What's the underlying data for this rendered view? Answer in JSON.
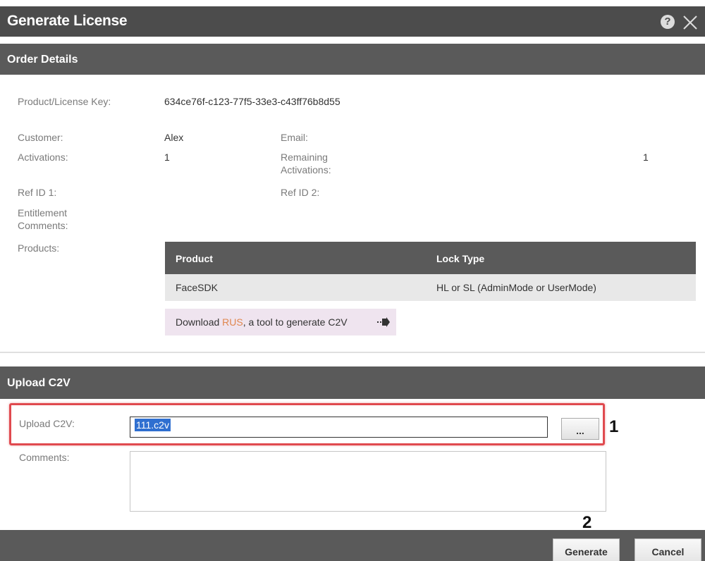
{
  "dialog": {
    "title": "Generate License",
    "help_glyph": "?",
    "icons": [
      "help-icon",
      "close-icon"
    ]
  },
  "order_details": {
    "section_title": "Order Details",
    "product_key_label": "Product/License Key:",
    "product_key_value": "634ce76f-c123-77f5-33e3-c43ff76b8d55",
    "customer_label": "Customer:",
    "customer_value": "Alex",
    "email_label": "Email:",
    "email_value": "",
    "activations_label": "Activations:",
    "activations_value": "1",
    "remaining_label": "Remaining Activations:",
    "remaining_value": "1",
    "ref1_label": "Ref ID 1:",
    "ref2_label": "Ref ID 2:",
    "entitlement_label": "Entitlement Comments:",
    "products_label": "Products:"
  },
  "products_table": {
    "headers": [
      "Product",
      "Lock Type"
    ],
    "rows": [
      [
        "FaceSDK",
        "HL or SL (AdminMode or UserMode)"
      ]
    ]
  },
  "download": {
    "prefix": "Download ",
    "link": "RUS",
    "suffix": ", a tool to generate C2V",
    "arrow_icon": "arrow-right-icon"
  },
  "upload": {
    "section_title": "Upload C2V",
    "file_label": "Upload C2V:",
    "file_value": "111.c2v",
    "browse_label": "...",
    "comments_label": "Comments:",
    "comments_value": ""
  },
  "annotations": {
    "marker_1": "1",
    "marker_2": "2"
  },
  "footer": {
    "generate_label": "Generate",
    "cancel_label": "Cancel"
  },
  "colors": {
    "title_bar": "#4c4c4c",
    "section_bar": "#5a5a5a",
    "highlight": "#e04a4f",
    "rus_link": "#e0874f",
    "download_bg": "#efe4ef",
    "selection": "#2f6fd0"
  }
}
